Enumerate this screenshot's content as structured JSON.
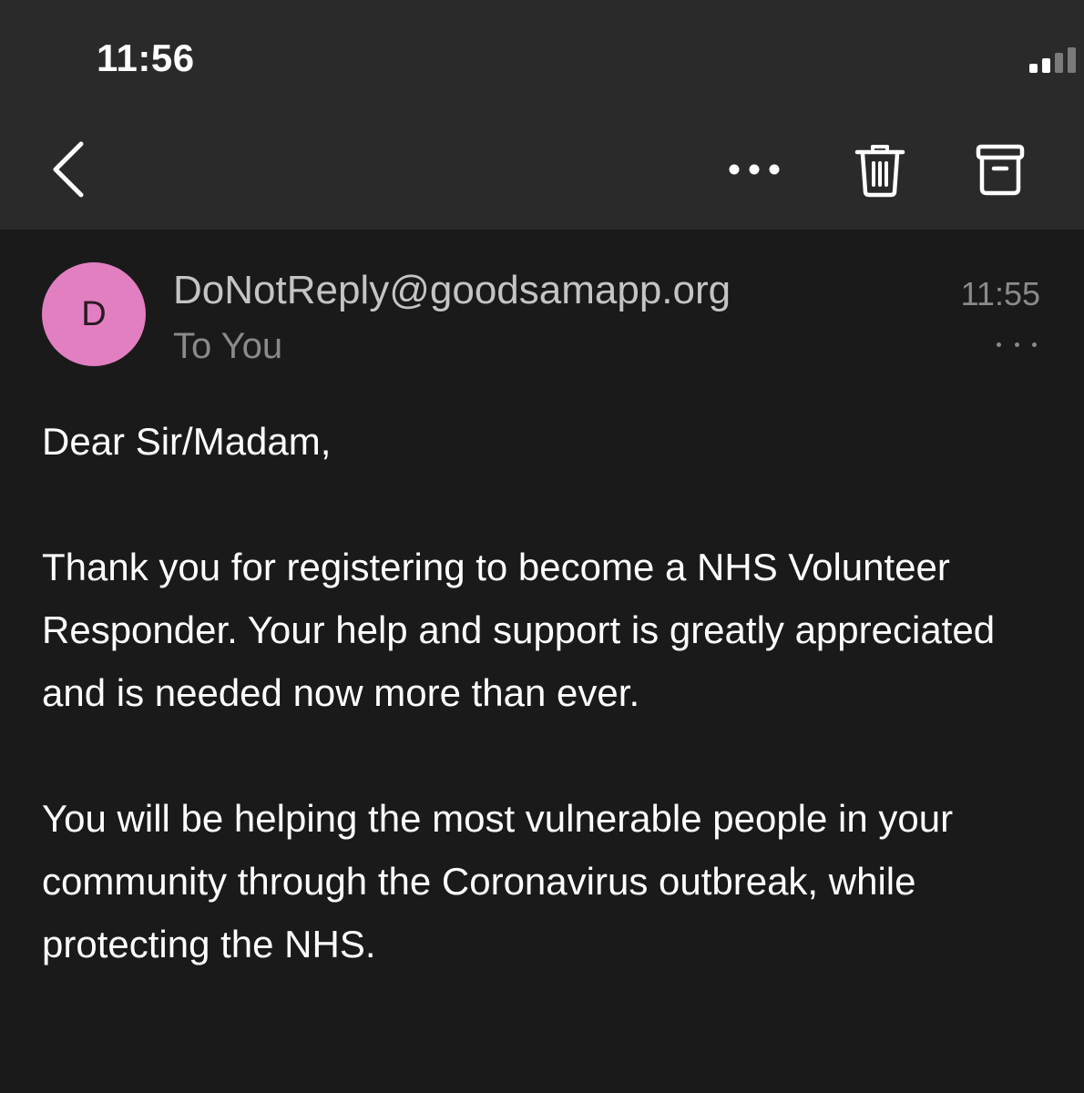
{
  "status_bar": {
    "time": "11:56",
    "icons": [
      "cellular-signal-icon",
      "wifi-icon",
      "battery-icon"
    ]
  },
  "nav": {
    "icons": [
      "chevron-left-icon",
      "more-horizontal-icon",
      "trash-icon",
      "archive-icon"
    ]
  },
  "message": {
    "avatar_initial": "D",
    "avatar_color": "#e27fc1",
    "sender": "DoNotReply@goodsamapp.org",
    "recipient": "To You",
    "time": "11:55",
    "body": [
      "Dear Sir/Madam,",
      "Thank you for registering to become a NHS Volunteer Responder. Your help and support is greatly appreciated and is needed now more than ever.",
      "You will be helping the most vulnerable people in your community through the Coronavirus outbreak, while protecting the NHS."
    ]
  },
  "colors": {
    "background": "#1a1a1a",
    "header_background": "#2a2a2a",
    "primary_text": "#ffffff",
    "secondary_text": "#8a8a8a"
  }
}
